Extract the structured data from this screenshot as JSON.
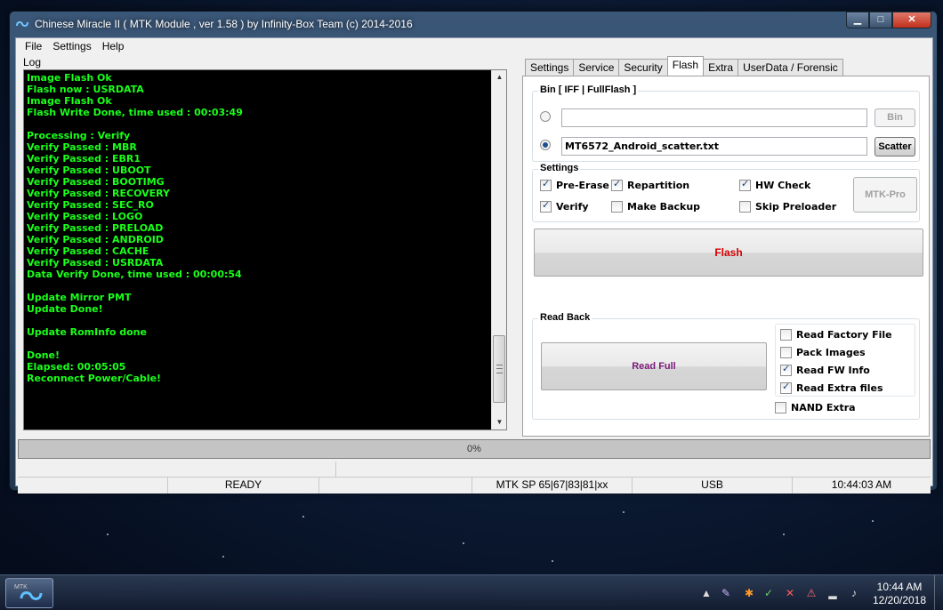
{
  "window": {
    "title": "Chinese Miracle II ( MTK Module , ver 1.58 ) by Infinity-Box Team (c) 2014-2016",
    "controls": {
      "minimize": "▁",
      "maximize": "□",
      "close": "✕"
    }
  },
  "menu": [
    "File",
    "Settings",
    "Help"
  ],
  "log": {
    "label": "Log",
    "text": "Image Flash Ok\nFlash now : USRDATA\nImage Flash Ok\nFlash Write Done, time used : 00:03:49\n\nProcessing : Verify\nVerify Passed : MBR\nVerify Passed : EBR1\nVerify Passed : UBOOT\nVerify Passed : BOOTIMG\nVerify Passed : RECOVERY\nVerify Passed : SEC_RO\nVerify Passed : LOGO\nVerify Passed : PRELOAD\nVerify Passed : ANDROID\nVerify Passed : CACHE\nVerify Passed : USRDATA\nData Verify Done, time used : 00:00:54\n\nUpdate Mirror PMT\nUpdate Done!\n\nUpdate RomInfo done\n\nDone!\nElapsed: 00:05:05\nReconnect Power/Cable!",
    "color": "#19ff19"
  },
  "tabs": [
    {
      "label": "Settings",
      "active": false
    },
    {
      "label": "Service",
      "active": false
    },
    {
      "label": "Security",
      "active": false
    },
    {
      "label": "Flash",
      "active": true
    },
    {
      "label": "Extra",
      "active": false
    },
    {
      "label": "UserData / Forensic",
      "active": false
    }
  ],
  "flash_tab": {
    "bin_group": {
      "title": "Bin  [ IFF | FullFlash ]",
      "bin_value": "",
      "bin_button": "Bin",
      "scatter_value": "MT6572_Android_scatter.txt",
      "scatter_button": "Scatter",
      "selected": "scatter"
    },
    "settings_group": {
      "title": "Settings",
      "options": {
        "pre_erase": {
          "label": "Pre-Erase",
          "checked": true
        },
        "repartition": {
          "label": "Repartition",
          "checked": true
        },
        "hw_check": {
          "label": "HW Check",
          "checked": true
        },
        "verify": {
          "label": "Verify",
          "checked": true
        },
        "make_backup": {
          "label": "Make Backup",
          "checked": false
        },
        "skip_preloader": {
          "label": "Skip Preloader",
          "checked": false
        }
      },
      "mtk_pro_button": "MTK-Pro"
    },
    "flash_button": {
      "label": "Flash",
      "color": "#d40000"
    },
    "read_back_group": {
      "title": "Read Back",
      "read_full_button": {
        "label": "Read Full",
        "color": "#7a1a7a"
      },
      "options": {
        "read_factory_file": {
          "label": "Read Factory File",
          "checked": false
        },
        "pack_images": {
          "label": "Pack Images",
          "checked": false
        },
        "read_fw_info": {
          "label": "Read FW Info",
          "checked": true
        },
        "read_extra_files": {
          "label": "Read Extra files",
          "checked": true
        }
      },
      "nand_extra": {
        "label": "NAND Extra",
        "checked": false
      }
    }
  },
  "progress": {
    "text": "0%",
    "value": 0
  },
  "statusbar": {
    "state": "READY",
    "platform": "MTK SP 65|67|83|81|xx",
    "connection": "USB",
    "time": "10:44:03 AM"
  },
  "taskbar": {
    "app_label": "MTK",
    "tray_expand": "▲",
    "clock_time": "10:44 AM",
    "clock_date": "12/20/2018"
  },
  "colors": {
    "accent_flash": "#d40000",
    "accent_readfull": "#7a1a7a",
    "log_bg": "#000000"
  }
}
